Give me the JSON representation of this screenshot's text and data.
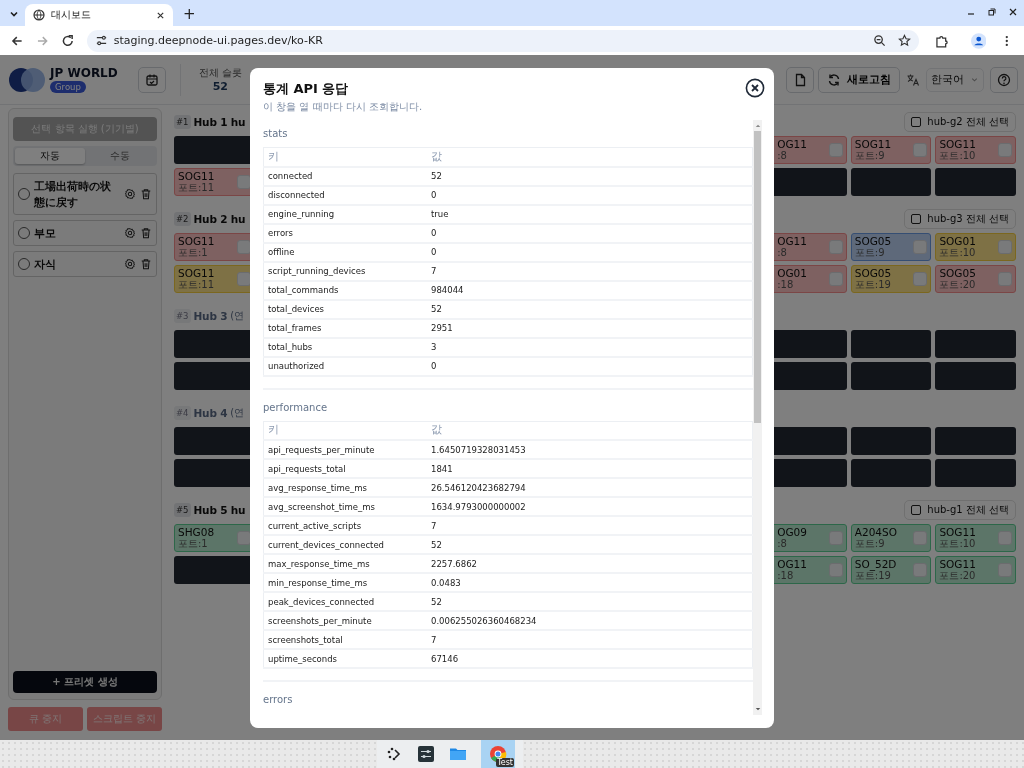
{
  "browser": {
    "tab_title": "대시보드",
    "new_tab": "+",
    "url": "staging.deepnode-ui.pages.dev/ko-KR"
  },
  "header": {
    "brand": "JP WORLD",
    "brand_badge": "Group",
    "slots_label": "전체 슬롯",
    "slots_value": "52",
    "refresh_label": "새로고침",
    "language": "한국어"
  },
  "sidebar": {
    "run_button": "선택 항목 실행 (기기별)",
    "modes": [
      {
        "label": "자동",
        "selected": true
      },
      {
        "label": "수동",
        "selected": false
      }
    ],
    "presets": [
      {
        "label": "工場出荷時の状態に戻す",
        "selected": false
      },
      {
        "label": "부모",
        "selected": false
      },
      {
        "label": "자식",
        "selected": false
      }
    ],
    "create_button": "+ 프리셋 생성",
    "stop_queue": "큐 중지",
    "stop_scripts": "스크립트 중지"
  },
  "hubs": [
    {
      "number": "#1",
      "title": "Hub 1 hu",
      "muted": false,
      "select_all": {
        "label": "hub-g2 전체 선택",
        "checked": false
      },
      "rows": [
        {
          "left": [
            {
              "kind": "offline"
            }
          ],
          "right": [
            {
              "kind": "error",
              "name": "OG11",
              "port": ":8",
              "checked": false
            },
            {
              "kind": "error",
              "name": "SOG11",
              "port": "포트:9",
              "checked": false
            },
            {
              "kind": "error",
              "name": "SOG11",
              "port": "포트:10",
              "checked": false
            }
          ]
        },
        {
          "left": [
            {
              "kind": "error",
              "name": "SOG11",
              "port": "포트:11",
              "checked": false
            }
          ],
          "right": [
            {
              "kind": "offline"
            },
            {
              "kind": "offline"
            },
            {
              "kind": "offline"
            }
          ]
        }
      ]
    },
    {
      "number": "#2",
      "title": "Hub 2 hu",
      "muted": false,
      "select_all": {
        "label": "hub-g3 전체 선택",
        "checked": false
      },
      "rows": [
        {
          "left": [
            {
              "kind": "error",
              "name": "SOG11",
              "port": "포트:1",
              "checked": false
            }
          ],
          "right": [
            {
              "kind": "error",
              "name": "OG11",
              "port": ":8",
              "checked": false
            },
            {
              "kind": "busy",
              "name": "SOG05",
              "port": "포트:9",
              "checked": false
            },
            {
              "kind": "warning",
              "name": "SOG01",
              "port": "포트:10",
              "checked": false
            }
          ]
        },
        {
          "left": [
            {
              "kind": "warning",
              "name": "SOG11",
              "port": "포트:11",
              "checked": false
            }
          ],
          "right": [
            {
              "kind": "error",
              "name": "OG01",
              "port": ":18",
              "checked": false
            },
            {
              "kind": "warning",
              "name": "SOG05",
              "port": "포트:19",
              "checked": false
            },
            {
              "kind": "error",
              "name": "SOG05",
              "port": "포트:20",
              "checked": false
            }
          ]
        }
      ]
    },
    {
      "number": "#3",
      "title": "Hub 3",
      "note": "(연",
      "muted": true,
      "rows": [
        {
          "left": [
            {
              "kind": "offline"
            }
          ],
          "right": [
            {
              "kind": "offline"
            },
            {
              "kind": "offline"
            },
            {
              "kind": "offline"
            }
          ]
        },
        {
          "left": [
            {
              "kind": "offline"
            }
          ],
          "right": [
            {
              "kind": "offline"
            },
            {
              "kind": "offline"
            },
            {
              "kind": "offline"
            }
          ]
        }
      ]
    },
    {
      "number": "#4",
      "title": "Hub 4",
      "note": "(연",
      "muted": true,
      "rows": [
        {
          "left": [
            {
              "kind": "offline"
            }
          ],
          "right": [
            {
              "kind": "offline"
            },
            {
              "kind": "offline"
            },
            {
              "kind": "offline"
            }
          ]
        },
        {
          "left": [
            {
              "kind": "offline"
            }
          ],
          "right": [
            {
              "kind": "offline"
            },
            {
              "kind": "offline"
            },
            {
              "kind": "offline"
            }
          ]
        }
      ]
    },
    {
      "number": "#5",
      "title": "Hub 5 hu",
      "muted": false,
      "select_all": {
        "label": "hub-g1 전체 선택",
        "checked": false
      },
      "rows": [
        {
          "left": [
            {
              "kind": "ok",
              "name": "SHG08",
              "port": "포트:1",
              "checked": false
            }
          ],
          "right": [
            {
              "kind": "ok",
              "name": "OG09",
              "port": ":8",
              "checked": false
            },
            {
              "kind": "ok",
              "name": "A204SO",
              "port": "포트:9",
              "checked": false
            },
            {
              "kind": "ok",
              "name": "SOG11",
              "port": "포트:10",
              "checked": false
            }
          ]
        },
        {
          "left": [
            {
              "kind": "offline"
            }
          ],
          "right": [
            {
              "kind": "ok",
              "name": "OG11",
              "port": ":18",
              "checked": false
            },
            {
              "kind": "ok",
              "name": "SO_52D",
              "port": "포트:19",
              "checked": false
            },
            {
              "kind": "ok",
              "name": "SOG11",
              "port": "포트:20",
              "checked": false
            }
          ]
        }
      ]
    }
  ],
  "modal": {
    "title": "통계 API 응답",
    "subtitle": "이 창을 열 때마다 다시 조회합니다.",
    "sections": [
      {
        "title": "stats",
        "columns": [
          "키",
          "값"
        ],
        "rows": [
          [
            "connected",
            "52"
          ],
          [
            "disconnected",
            "0"
          ],
          [
            "engine_running",
            "true"
          ],
          [
            "errors",
            "0"
          ],
          [
            "offline",
            "0"
          ],
          [
            "script_running_devices",
            "7"
          ],
          [
            "total_commands",
            "984044"
          ],
          [
            "total_devices",
            "52"
          ],
          [
            "total_frames",
            "2951"
          ],
          [
            "total_hubs",
            "3"
          ],
          [
            "unauthorized",
            "0"
          ]
        ]
      },
      {
        "title": "performance",
        "columns": [
          "키",
          "값"
        ],
        "rows": [
          [
            "api_requests_per_minute",
            "1.6450719328031453"
          ],
          [
            "api_requests_total",
            "1841"
          ],
          [
            "avg_response_time_ms",
            "26.546120423682794"
          ],
          [
            "avg_screenshot_time_ms",
            "1634.9793000000002"
          ],
          [
            "current_active_scripts",
            "7"
          ],
          [
            "current_devices_connected",
            "52"
          ],
          [
            "max_response_time_ms",
            "2257.6862"
          ],
          [
            "min_response_time_ms",
            "0.0483"
          ],
          [
            "peak_devices_connected",
            "52"
          ],
          [
            "screenshots_per_minute",
            "0.006255026360468234"
          ],
          [
            "screenshots_total",
            "7"
          ],
          [
            "uptime_seconds",
            "67146"
          ]
        ]
      },
      {
        "title": "errors"
      }
    ]
  },
  "taskbar": {
    "badge": "Test"
  }
}
